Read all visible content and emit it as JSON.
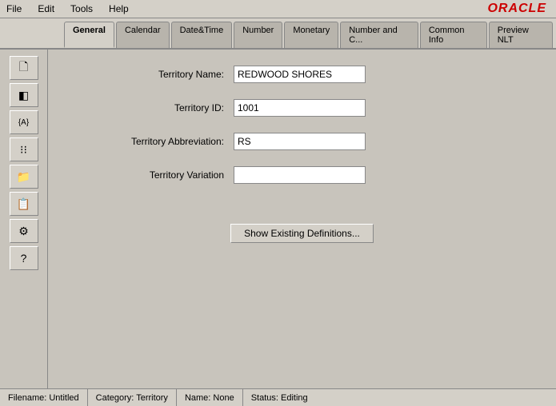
{
  "app": {
    "logo": "ORACLE"
  },
  "menu": {
    "items": [
      "File",
      "Edit",
      "Tools",
      "Help"
    ]
  },
  "tabs": [
    {
      "label": "General",
      "active": true
    },
    {
      "label": "Calendar",
      "active": false
    },
    {
      "label": "Date&Time",
      "active": false
    },
    {
      "label": "Number",
      "active": false
    },
    {
      "label": "Monetary",
      "active": false
    },
    {
      "label": "Number and C...",
      "active": false
    },
    {
      "label": "Common Info",
      "active": false
    },
    {
      "label": "Preview NLT",
      "active": false
    }
  ],
  "sidebar": {
    "buttons": [
      {
        "icon": "🖹",
        "name": "document-icon"
      },
      {
        "icon": "◧",
        "name": "layout-icon"
      },
      {
        "icon": "{A}",
        "name": "variable-icon"
      },
      {
        "icon": "⁙",
        "name": "dots-icon"
      },
      {
        "icon": "📁",
        "name": "folder-icon"
      },
      {
        "icon": "📋",
        "name": "clipboard-icon"
      },
      {
        "icon": "⚙",
        "name": "settings-icon"
      },
      {
        "icon": "?",
        "name": "help-icon"
      }
    ]
  },
  "form": {
    "fields": [
      {
        "label": "Territory Name:",
        "value": "REDWOOD SHORES",
        "name": "territory-name"
      },
      {
        "label": "Territory ID:",
        "value": "1001",
        "name": "territory-id"
      },
      {
        "label": "Territory Abbreviation:",
        "value": "RS",
        "name": "territory-abbreviation"
      },
      {
        "label": "Territory Variation",
        "value": "",
        "name": "territory-variation"
      }
    ],
    "show_button_label": "Show Existing Definitions..."
  },
  "status_bar": {
    "filename": "Filename: Untitled",
    "category": "Category: Territory",
    "name": "Name: None",
    "status": "Status: Editing"
  }
}
